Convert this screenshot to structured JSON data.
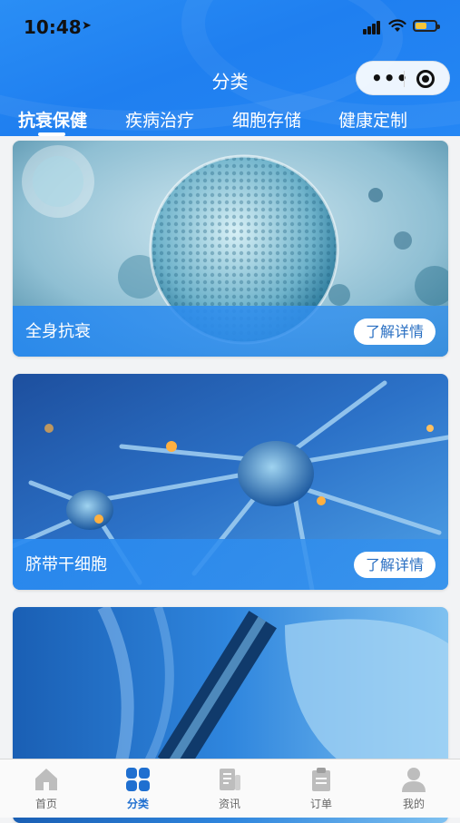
{
  "status_bar": {
    "time": "10:48",
    "location_glyph": "➤"
  },
  "header": {
    "title": "分类",
    "menu_glyph": "•••"
  },
  "tabs": [
    {
      "label": "抗衰保健",
      "active": true
    },
    {
      "label": "疾病治疗",
      "active": false
    },
    {
      "label": "细胞存储",
      "active": false
    },
    {
      "label": "健康定制",
      "active": false
    }
  ],
  "cards": [
    {
      "name": "全身抗衰",
      "button": "了解详情"
    },
    {
      "name": "脐带干细胞",
      "button": "了解详情"
    },
    {
      "name": "",
      "button": ""
    }
  ],
  "tabbar": [
    {
      "label": "首页",
      "icon": "home-icon",
      "active": false
    },
    {
      "label": "分类",
      "icon": "grid-icon",
      "active": true
    },
    {
      "label": "资讯",
      "icon": "news-icon",
      "active": false
    },
    {
      "label": "订单",
      "icon": "clipboard-icon",
      "active": false
    },
    {
      "label": "我的",
      "icon": "user-icon",
      "active": false
    }
  ],
  "colors": {
    "brand": "#2587f4",
    "active_tab_icon": "#1f6fd0",
    "inactive_icon": "#bdbdbd"
  }
}
